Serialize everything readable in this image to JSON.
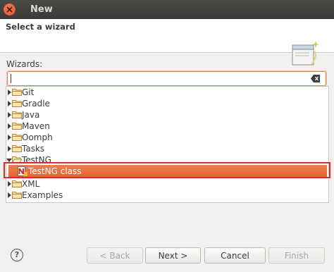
{
  "window": {
    "title": "New"
  },
  "header": {
    "title": "Select a wizard"
  },
  "wizards_label": "Wizards:",
  "filter": {
    "value": "",
    "placeholder": ""
  },
  "tree": {
    "items": [
      {
        "label": "Git",
        "expanded": false
      },
      {
        "label": "Gradle",
        "expanded": false
      },
      {
        "label": "Java",
        "expanded": false
      },
      {
        "label": "Maven",
        "expanded": false
      },
      {
        "label": "Oomph",
        "expanded": false
      },
      {
        "label": "Tasks",
        "expanded": false
      },
      {
        "label": "TestNG",
        "expanded": true
      },
      {
        "label": "TestNG class",
        "selected": true
      },
      {
        "label": "XML",
        "expanded": false
      },
      {
        "label": "Examples",
        "expanded": false
      }
    ]
  },
  "buttons": {
    "help": "?",
    "back": "< Back",
    "next": "Next >",
    "cancel": "Cancel",
    "finish": "Finish"
  },
  "colors": {
    "accent": "#e9692f",
    "highlight_frame": "#e12828",
    "titlebar": "#3c3b37"
  }
}
